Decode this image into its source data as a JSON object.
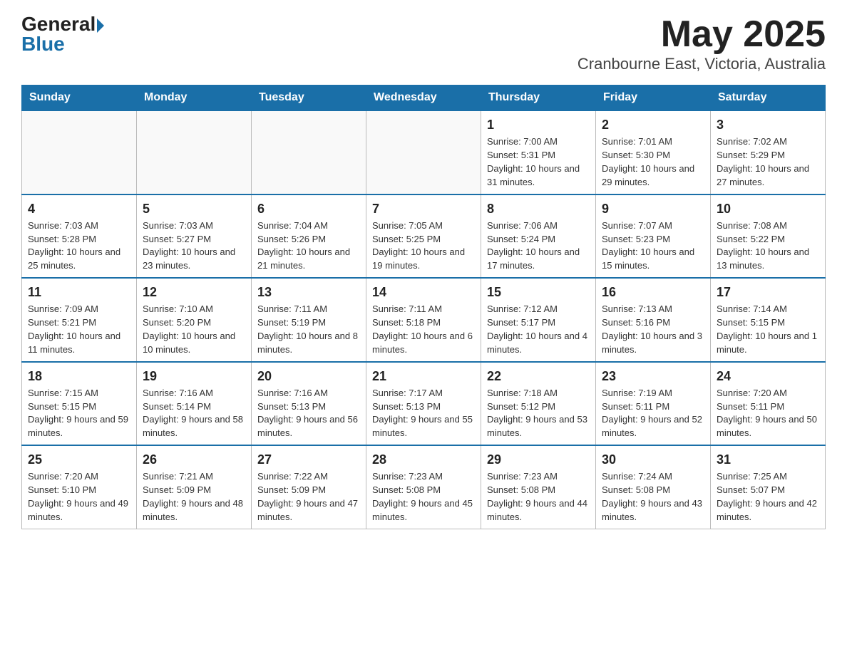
{
  "header": {
    "logo_general": "General",
    "logo_blue": "Blue",
    "month_title": "May 2025",
    "location": "Cranbourne East, Victoria, Australia"
  },
  "weekdays": [
    "Sunday",
    "Monday",
    "Tuesday",
    "Wednesday",
    "Thursday",
    "Friday",
    "Saturday"
  ],
  "weeks": [
    [
      {
        "day": "",
        "info": ""
      },
      {
        "day": "",
        "info": ""
      },
      {
        "day": "",
        "info": ""
      },
      {
        "day": "",
        "info": ""
      },
      {
        "day": "1",
        "info": "Sunrise: 7:00 AM\nSunset: 5:31 PM\nDaylight: 10 hours and 31 minutes."
      },
      {
        "day": "2",
        "info": "Sunrise: 7:01 AM\nSunset: 5:30 PM\nDaylight: 10 hours and 29 minutes."
      },
      {
        "day": "3",
        "info": "Sunrise: 7:02 AM\nSunset: 5:29 PM\nDaylight: 10 hours and 27 minutes."
      }
    ],
    [
      {
        "day": "4",
        "info": "Sunrise: 7:03 AM\nSunset: 5:28 PM\nDaylight: 10 hours and 25 minutes."
      },
      {
        "day": "5",
        "info": "Sunrise: 7:03 AM\nSunset: 5:27 PM\nDaylight: 10 hours and 23 minutes."
      },
      {
        "day": "6",
        "info": "Sunrise: 7:04 AM\nSunset: 5:26 PM\nDaylight: 10 hours and 21 minutes."
      },
      {
        "day": "7",
        "info": "Sunrise: 7:05 AM\nSunset: 5:25 PM\nDaylight: 10 hours and 19 minutes."
      },
      {
        "day": "8",
        "info": "Sunrise: 7:06 AM\nSunset: 5:24 PM\nDaylight: 10 hours and 17 minutes."
      },
      {
        "day": "9",
        "info": "Sunrise: 7:07 AM\nSunset: 5:23 PM\nDaylight: 10 hours and 15 minutes."
      },
      {
        "day": "10",
        "info": "Sunrise: 7:08 AM\nSunset: 5:22 PM\nDaylight: 10 hours and 13 minutes."
      }
    ],
    [
      {
        "day": "11",
        "info": "Sunrise: 7:09 AM\nSunset: 5:21 PM\nDaylight: 10 hours and 11 minutes."
      },
      {
        "day": "12",
        "info": "Sunrise: 7:10 AM\nSunset: 5:20 PM\nDaylight: 10 hours and 10 minutes."
      },
      {
        "day": "13",
        "info": "Sunrise: 7:11 AM\nSunset: 5:19 PM\nDaylight: 10 hours and 8 minutes."
      },
      {
        "day": "14",
        "info": "Sunrise: 7:11 AM\nSunset: 5:18 PM\nDaylight: 10 hours and 6 minutes."
      },
      {
        "day": "15",
        "info": "Sunrise: 7:12 AM\nSunset: 5:17 PM\nDaylight: 10 hours and 4 minutes."
      },
      {
        "day": "16",
        "info": "Sunrise: 7:13 AM\nSunset: 5:16 PM\nDaylight: 10 hours and 3 minutes."
      },
      {
        "day": "17",
        "info": "Sunrise: 7:14 AM\nSunset: 5:15 PM\nDaylight: 10 hours and 1 minute."
      }
    ],
    [
      {
        "day": "18",
        "info": "Sunrise: 7:15 AM\nSunset: 5:15 PM\nDaylight: 9 hours and 59 minutes."
      },
      {
        "day": "19",
        "info": "Sunrise: 7:16 AM\nSunset: 5:14 PM\nDaylight: 9 hours and 58 minutes."
      },
      {
        "day": "20",
        "info": "Sunrise: 7:16 AM\nSunset: 5:13 PM\nDaylight: 9 hours and 56 minutes."
      },
      {
        "day": "21",
        "info": "Sunrise: 7:17 AM\nSunset: 5:13 PM\nDaylight: 9 hours and 55 minutes."
      },
      {
        "day": "22",
        "info": "Sunrise: 7:18 AM\nSunset: 5:12 PM\nDaylight: 9 hours and 53 minutes."
      },
      {
        "day": "23",
        "info": "Sunrise: 7:19 AM\nSunset: 5:11 PM\nDaylight: 9 hours and 52 minutes."
      },
      {
        "day": "24",
        "info": "Sunrise: 7:20 AM\nSunset: 5:11 PM\nDaylight: 9 hours and 50 minutes."
      }
    ],
    [
      {
        "day": "25",
        "info": "Sunrise: 7:20 AM\nSunset: 5:10 PM\nDaylight: 9 hours and 49 minutes."
      },
      {
        "day": "26",
        "info": "Sunrise: 7:21 AM\nSunset: 5:09 PM\nDaylight: 9 hours and 48 minutes."
      },
      {
        "day": "27",
        "info": "Sunrise: 7:22 AM\nSunset: 5:09 PM\nDaylight: 9 hours and 47 minutes."
      },
      {
        "day": "28",
        "info": "Sunrise: 7:23 AM\nSunset: 5:08 PM\nDaylight: 9 hours and 45 minutes."
      },
      {
        "day": "29",
        "info": "Sunrise: 7:23 AM\nSunset: 5:08 PM\nDaylight: 9 hours and 44 minutes."
      },
      {
        "day": "30",
        "info": "Sunrise: 7:24 AM\nSunset: 5:08 PM\nDaylight: 9 hours and 43 minutes."
      },
      {
        "day": "31",
        "info": "Sunrise: 7:25 AM\nSunset: 5:07 PM\nDaylight: 9 hours and 42 minutes."
      }
    ]
  ]
}
